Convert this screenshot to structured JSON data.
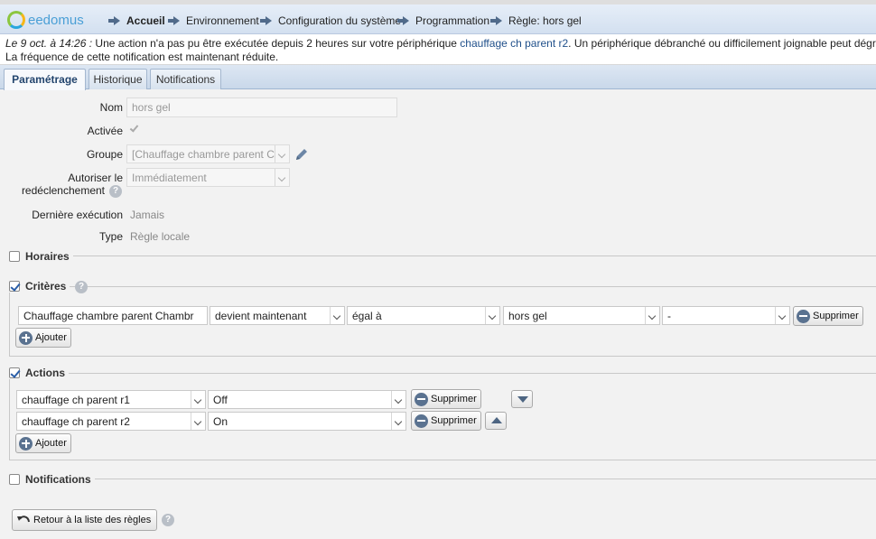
{
  "header": {
    "logo_text": "eedomus",
    "breadcrumbs": [
      "Accueil",
      "Environnement",
      "Configuration du système",
      "Programmation",
      "Règle: hors gel"
    ]
  },
  "notice": {
    "date": "Le 9 oct. à 14:26 :",
    "text1": " Une action n'a pas pu être exécutée depuis 2 heures sur votre périphérique ",
    "device": "chauffage ch parent r2",
    "text2": ". Un périphérique débranché ou difficilement joignable peut dégr",
    "line2": "La fréquence de cette notification est maintenant réduite."
  },
  "tabs": [
    "Paramétrage",
    "Historique",
    "Notifications"
  ],
  "form": {
    "nom_label": "Nom",
    "nom_value": "hors gel",
    "activee_label": "Activée",
    "groupe_label": "Groupe",
    "groupe_value": "[Chauffage chambre parent C",
    "autoriser_label_1": "Autoriser le",
    "autoriser_label_2": "redéclenchement",
    "autoriser_value": "Immédiatement",
    "derniere_label": "Dernière exécution",
    "derniere_value": "Jamais",
    "type_label": "Type",
    "type_value": "Règle locale"
  },
  "sections": {
    "horaires": "Horaires",
    "criteres": "Critères",
    "actions": "Actions",
    "notifications": "Notifications"
  },
  "criteres": {
    "device": "Chauffage chambre parent Chambr",
    "condition": "devient maintenant",
    "operator": "égal à",
    "value": "hors gel",
    "extra": "-",
    "delete_label": "Supprimer",
    "add_label": "Ajouter"
  },
  "actions": {
    "rows": [
      {
        "device": "chauffage ch parent r1",
        "value": "Off",
        "delete_label": "Supprimer"
      },
      {
        "device": "chauffage ch parent r2",
        "value": "On",
        "delete_label": "Supprimer"
      }
    ],
    "add_label": "Ajouter"
  },
  "footer": {
    "back_label": "Retour à la liste des règles"
  },
  "help_glyph": "?"
}
